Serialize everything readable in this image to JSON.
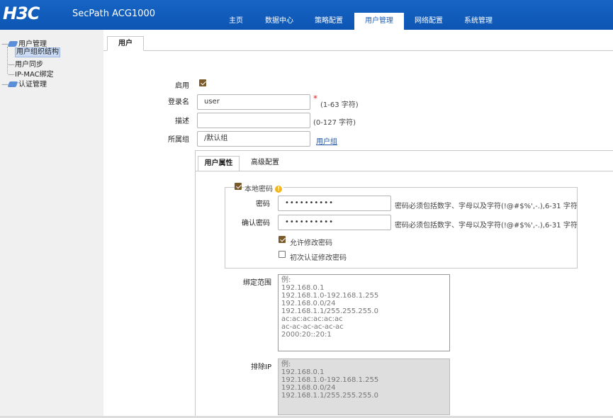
{
  "header": {
    "logo": "H3C",
    "product": "SecPath ACG1000",
    "nav": [
      "主页",
      "数据中心",
      "策略配置",
      "用户管理",
      "网络配置",
      "系统管理"
    ],
    "active_nav": "用户管理"
  },
  "sidebar": {
    "groups": [
      {
        "label": "用户管理",
        "items": [
          "用户组织结构",
          "用户同步",
          "IP-MAC绑定"
        ]
      },
      {
        "label": "认证管理",
        "items": []
      }
    ],
    "selected": "用户组织结构"
  },
  "main": {
    "tab": "用户",
    "form": {
      "enable_label": "启用",
      "enable_checked": true,
      "login_label": "登录名",
      "login_value": "user",
      "login_required": "*",
      "login_hint": "(1-63 字符)",
      "desc_label": "描述",
      "desc_value": "",
      "desc_hint": "(0-127 字符)",
      "group_label": "所属组",
      "group_value": "/默认组",
      "group_link": "用户组"
    },
    "subtabs": [
      "用户属性",
      "高级配置"
    ],
    "active_subtab": "用户属性",
    "local_password": {
      "label": "本地密码",
      "checked": true,
      "password_label": "密码",
      "password_value": "••••••••••",
      "password_hint": "密码必须包括数字、字母以及字符(!@#$%',-.),6-31 字符",
      "confirm_label": "确认密码",
      "confirm_value": "••••••••••",
      "confirm_hint": "密码必须包括数字、字母以及字符(!@#$%',-.),6-31 字符",
      "allow_change_label": "允许修改密码",
      "allow_change_checked": true,
      "first_change_label": "初次认证修改密码",
      "first_change_checked": false
    },
    "bind_range": {
      "label": "绑定范围",
      "placeholder": "例:\n192.168.0.1\n192.168.1.0-192.168.1.255\n192.168.0.0/24\n192.168.1.1/255.255.255.0\nac:ac:ac:ac:ac:ac\nac-ac-ac-ac-ac-ac\n2000:20::20:1"
    },
    "exclude_ip": {
      "label": "排除IP",
      "placeholder": "例:\n192.168.0.1\n192.168.1.0-192.168.1.255\n192.168.0.0/24\n192.168.1.1/255.255.255.0"
    }
  },
  "colors": {
    "header_blue": "#1664c4",
    "sidebar_bg": "#f0f0f0",
    "checkbox": "#7a5a2c",
    "required": "#e02020"
  }
}
